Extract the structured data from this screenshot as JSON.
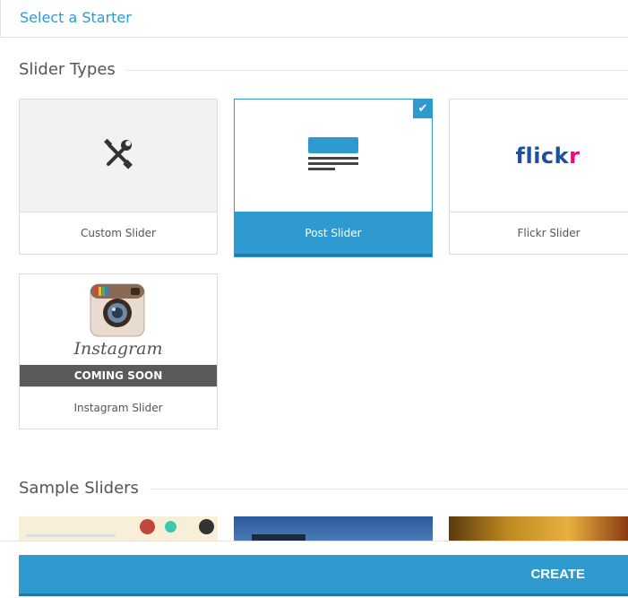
{
  "header": {
    "title": "Select a Starter"
  },
  "sections": {
    "slider_types": "Slider Types",
    "sample_sliders": "Sample Sliders"
  },
  "cards": [
    {
      "label": "Custom Slider",
      "icon": "wrench-screwdriver-icon"
    },
    {
      "label": "Post Slider",
      "icon": "post-layout-icon",
      "selected": true
    },
    {
      "label": "Flickr Slider",
      "icon": "flickr-logo",
      "logo_a": "flick",
      "logo_b": "r"
    },
    {
      "label": "Instagram Slider",
      "icon": "instagram-logo",
      "logo_text": "Instagram",
      "badge": "COMING SOON"
    }
  ],
  "footer": {
    "create_label": "CREATE"
  },
  "colors": {
    "accent": "#2e9ad0",
    "accent_dark": "#1e79a8",
    "flickr_blue": "#1f4fa0",
    "flickr_pink": "#ff0084"
  }
}
